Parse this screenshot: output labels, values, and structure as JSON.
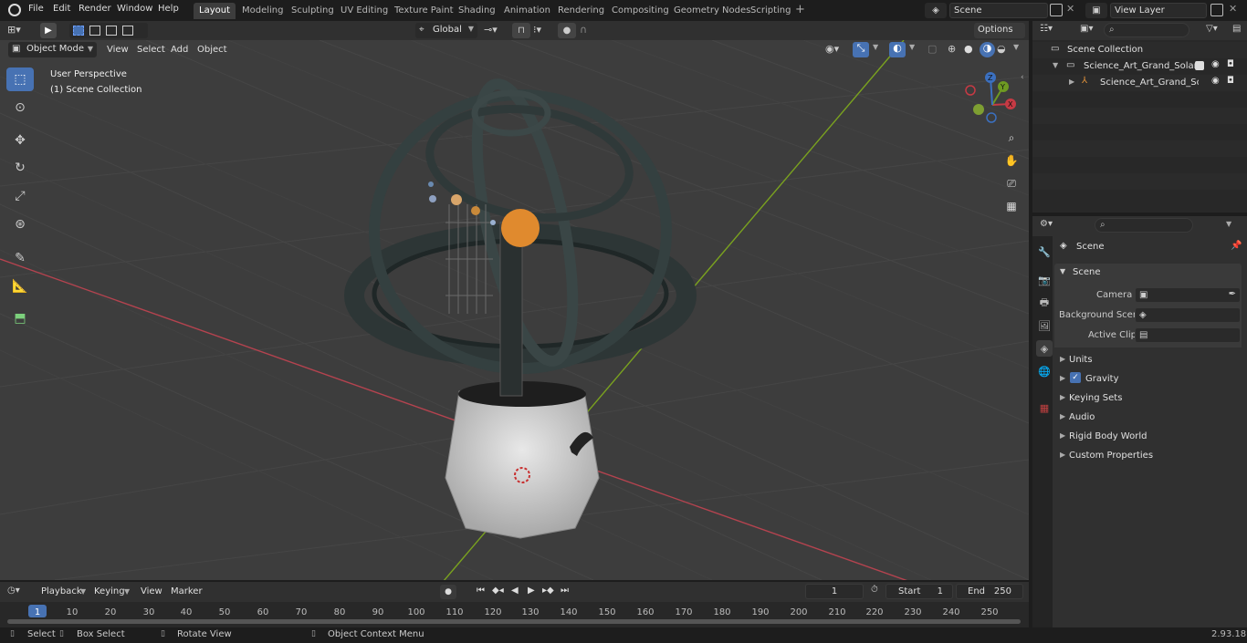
{
  "topbar": {
    "menus": [
      "File",
      "Edit",
      "Render",
      "Window",
      "Help"
    ],
    "workspaces": [
      "Layout",
      "Modeling",
      "Sculpting",
      "UV Editing",
      "Texture Paint",
      "Shading",
      "Animation",
      "Rendering",
      "Compositing",
      "Geometry Nodes",
      "Scripting"
    ],
    "active_workspace": "Layout",
    "add_tab": "+",
    "scene_name": "Scene",
    "view_layer": "View Layer"
  },
  "viewport_header": {
    "mode": "Object Mode",
    "menus": [
      "View",
      "Select",
      "Add",
      "Object"
    ],
    "transform_orientation": "Global",
    "options": "Options"
  },
  "viewport": {
    "perspective_label": "User Perspective",
    "collection_label": "(1) Scene Collection",
    "gizmo": {
      "x": "X",
      "y": "Y",
      "z": "Z"
    }
  },
  "outliner": {
    "root": "Scene Collection",
    "collection": "Science_Art_Grand_Solar_Sys",
    "object": "Science_Art_Grand_Solar"
  },
  "properties": {
    "context": "Scene",
    "panel": "Scene",
    "camera_label": "Camera",
    "background_scene_label": "Background Scene",
    "active_clip_label": "Active Clip",
    "subpanels": [
      "Units",
      "Gravity",
      "Keying Sets",
      "Audio",
      "Rigid Body World",
      "Custom Properties"
    ]
  },
  "timeline": {
    "menus": [
      "Playback",
      "Keying",
      "View",
      "Marker"
    ],
    "current_frame": "1",
    "start_label": "Start",
    "start": "1",
    "end_label": "End",
    "end": "250",
    "ruler": [
      "1",
      "10",
      "20",
      "30",
      "40",
      "50",
      "60",
      "70",
      "80",
      "90",
      "100",
      "110",
      "120",
      "130",
      "140",
      "150",
      "160",
      "170",
      "180",
      "190",
      "200",
      "210",
      "220",
      "230",
      "240",
      "250"
    ]
  },
  "statusbar": {
    "select": "Select",
    "box_select": "Box Select",
    "rotate_view": "Rotate View",
    "context_menu": "Object Context Menu",
    "version": "2.93.18"
  },
  "colors": {
    "accent": "#4772b3",
    "sun": "#e08a2e",
    "x_axis": "#c63a44",
    "y_axis": "#6e9a22"
  }
}
